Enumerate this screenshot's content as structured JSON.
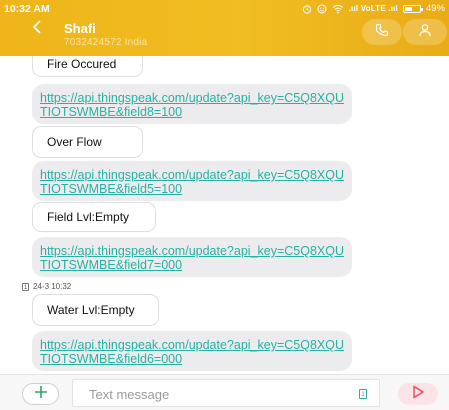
{
  "status_bar": {
    "time": "10:32 AM",
    "signal_text": ".ııl VoLTE .ııl",
    "battery": "49%",
    "battery_level": 0.49
  },
  "conversation": {
    "contact_name": "Shafi",
    "contact_number": "7032424572 India"
  },
  "messages": [
    {
      "type": "text",
      "text": "Fire Occured"
    },
    {
      "type": "link",
      "text": "https://api.thingspeak.com/update?api_key=C5Q8XQUTIOTSWMBE&field8=100"
    },
    {
      "type": "text",
      "text": "Over Flow"
    },
    {
      "type": "link",
      "text": "https://api.thingspeak.com/update?api_key=C5Q8XQUTIOTSWMBE&field5=100"
    },
    {
      "type": "text",
      "text": "Field Lvl:Empty"
    },
    {
      "type": "link",
      "text": "https://api.thingspeak.com/update?api_key=C5Q8XQUTIOTSWMBE&field7=000"
    },
    {
      "type": "date",
      "text": "24-3 10:32",
      "sim": "1"
    },
    {
      "type": "text",
      "text": "Water Lvl:Empty"
    },
    {
      "type": "link",
      "text": "https://api.thingspeak.com/update?api_key=C5Q8XQUTIOTSWMBE&field6=000"
    }
  ],
  "composer": {
    "placeholder": "Text message",
    "sim_label": "1"
  },
  "colors": {
    "header": "#efb51a",
    "link": "#27b1a2",
    "add_icon": "#2fa36b",
    "send_icon": "#e8495f",
    "link_bubble": "#ececee"
  },
  "icons": {
    "back": "back-arrow-icon",
    "call": "phone-icon",
    "contact": "person-icon",
    "add": "plus-icon",
    "send": "send-icon"
  }
}
